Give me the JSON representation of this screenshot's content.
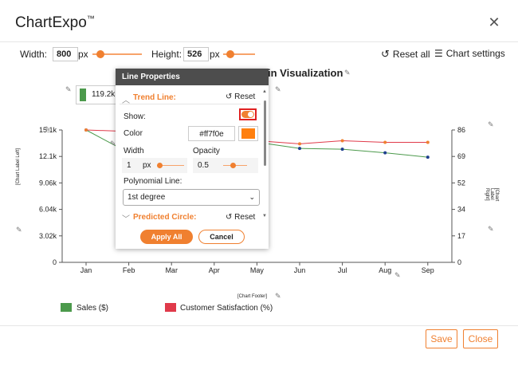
{
  "header": {
    "title": "ChartExpo",
    "tm": "™"
  },
  "toolbar": {
    "width_label": "Width:",
    "width_value": "800",
    "width_unit": "px",
    "height_label": "Height:",
    "height_value": "526",
    "height_unit": "px",
    "reset_all_label": "Reset all",
    "chart_settings_label": "Chart settings"
  },
  "chart": {
    "title_partial": "in Visualization",
    "tooltip_value": "119.2k",
    "left_axis_label": "[Chart Label Left]",
    "right_axis_label": "[Chart Label Right]",
    "footer_label": "[Chart Footer]"
  },
  "panel": {
    "title": "Line Properties",
    "trend_line_label": "Trend Line:",
    "reset_label": "Reset",
    "show_label": "Show:",
    "color_label": "Color",
    "color_value": "#ff7f0e",
    "width_label": "Width",
    "width_value": "1",
    "width_unit": "px",
    "opacity_label": "Opacity",
    "opacity_value": "0.5",
    "poly_label": "Polynomial Line:",
    "poly_value": "1st degree",
    "predicted_label": "Predicted Circle:",
    "predicted_reset_label": "Reset",
    "apply_label": "Apply All",
    "cancel_label": "Cancel"
  },
  "footer": {
    "save_label": "Save",
    "close_label": "Close"
  },
  "colors": {
    "accent": "#f08030",
    "sales": "#4c9a4c",
    "satisfaction": "#e03a4a",
    "trend_swatch": "#ff7f0e"
  },
  "chart_data": {
    "type": "line",
    "categories": [
      "Jan",
      "Feb",
      "Mar",
      "Apr",
      "May",
      "Jun",
      "Jul",
      "Aug",
      "Sep"
    ],
    "y_left_ticks": [
      "0",
      "3.02k",
      "6.04k",
      "9.06k",
      "12.1k",
      "15.1k"
    ],
    "y_right_ticks": [
      "0",
      "17",
      "34",
      "52",
      "69",
      "86"
    ],
    "ylim_left": [
      0,
      15100
    ],
    "ylim_right": [
      0,
      86
    ],
    "series": [
      {
        "name": "Sales ($)",
        "axis": "left",
        "values": [
          15100,
          12500,
          null,
          null,
          13700,
          13000,
          12900,
          12500,
          12000
        ]
      },
      {
        "name": "Customer Satisfaction (%)",
        "axis": "right",
        "values": [
          86,
          85,
          null,
          null,
          79,
          77,
          79,
          78,
          78
        ]
      }
    ],
    "legend_position": "bottom-left"
  }
}
